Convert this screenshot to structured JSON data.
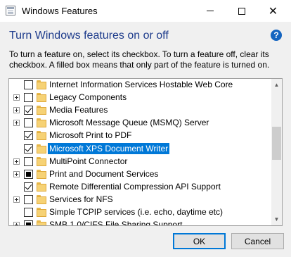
{
  "window": {
    "title": "Windows Features",
    "icon": "windows-features-icon",
    "controls": {
      "minimize": "minimize-icon",
      "maximize": "maximize-icon",
      "close": "close-icon"
    }
  },
  "heading": "Turn Windows features on or off",
  "help": {
    "icon": "help-icon",
    "glyph": "?"
  },
  "description": {
    "line1": "To turn a feature on, select its checkbox. To turn a feature off, clear its",
    "line2": "checkbox. A filled box means that only part of the feature is turned on."
  },
  "features": [
    {
      "label": "Internet Information Services Hostable Web Core",
      "state": "unchecked",
      "expandable": false,
      "selected": false
    },
    {
      "label": "Legacy Components",
      "state": "unchecked",
      "expandable": true,
      "selected": false
    },
    {
      "label": "Media Features",
      "state": "checked",
      "expandable": true,
      "selected": false
    },
    {
      "label": "Microsoft Message Queue (MSMQ) Server",
      "state": "unchecked",
      "expandable": true,
      "selected": false
    },
    {
      "label": "Microsoft Print to PDF",
      "state": "checked",
      "expandable": false,
      "selected": false
    },
    {
      "label": "Microsoft XPS Document Writer",
      "state": "checked",
      "expandable": false,
      "selected": true
    },
    {
      "label": "MultiPoint Connector",
      "state": "unchecked",
      "expandable": true,
      "selected": false
    },
    {
      "label": "Print and Document Services",
      "state": "partial",
      "expandable": true,
      "selected": false
    },
    {
      "label": "Remote Differential Compression API Support",
      "state": "checked",
      "expandable": false,
      "selected": false
    },
    {
      "label": "Services for NFS",
      "state": "unchecked",
      "expandable": true,
      "selected": false
    },
    {
      "label": "Simple TCPIP services (i.e. echo, daytime etc)",
      "state": "unchecked",
      "expandable": false,
      "selected": false
    },
    {
      "label": "SMB 1.0/CIFS File Sharing Support",
      "state": "partial",
      "expandable": true,
      "selected": false
    }
  ],
  "scrollbar": {
    "up": "scroll-up-icon",
    "down": "scroll-down-icon"
  },
  "buttons": {
    "ok": "OK",
    "cancel": "Cancel"
  },
  "colors": {
    "heading": "#1e3c8c",
    "selection": "#0078d7",
    "folder": "#f6d275"
  }
}
